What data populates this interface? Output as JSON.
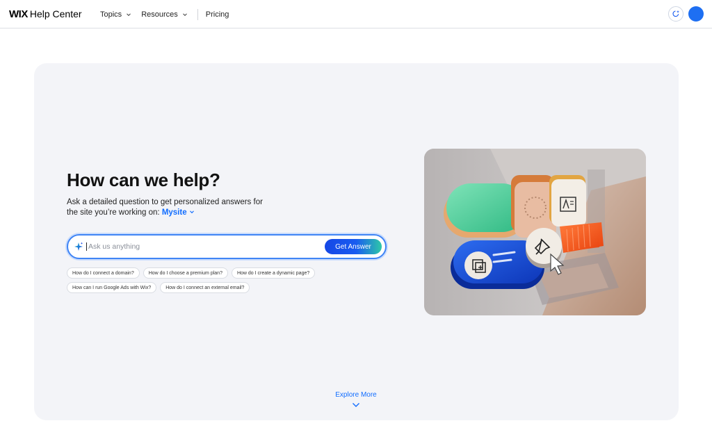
{
  "header": {
    "logo_mark": "WIX",
    "logo_text": "Help Center",
    "nav": [
      {
        "label": "Topics"
      },
      {
        "label": "Resources"
      },
      {
        "label": "Pricing"
      }
    ]
  },
  "hero": {
    "title": "How can we help?",
    "subtitle_line": "Ask a detailed question to get personalized answers for the site you’re working on:",
    "site_name": "Mysite",
    "search": {
      "placeholder": "Ask us anything",
      "button_label": "Get Answer"
    },
    "suggestions_row1": [
      "How do I connect a domain?",
      "How do I choose a premium plan?",
      "How do I create a dynamic page?"
    ],
    "suggestions_row2": [
      "How can I run Google Ads with Wix?",
      "How do I connect an external email?"
    ],
    "explore_label": "Explore More"
  },
  "colors": {
    "accent": "#116dff",
    "avatar": "#1e6ff2",
    "hero_bg": "#f3f4f8"
  },
  "icons": [
    "chevron-down-icon",
    "ai-sparkle-icon",
    "avatar",
    "illustration-pin-icon",
    "illustration-add-page-icon",
    "illustration-text-icon",
    "cursor-icon"
  ]
}
